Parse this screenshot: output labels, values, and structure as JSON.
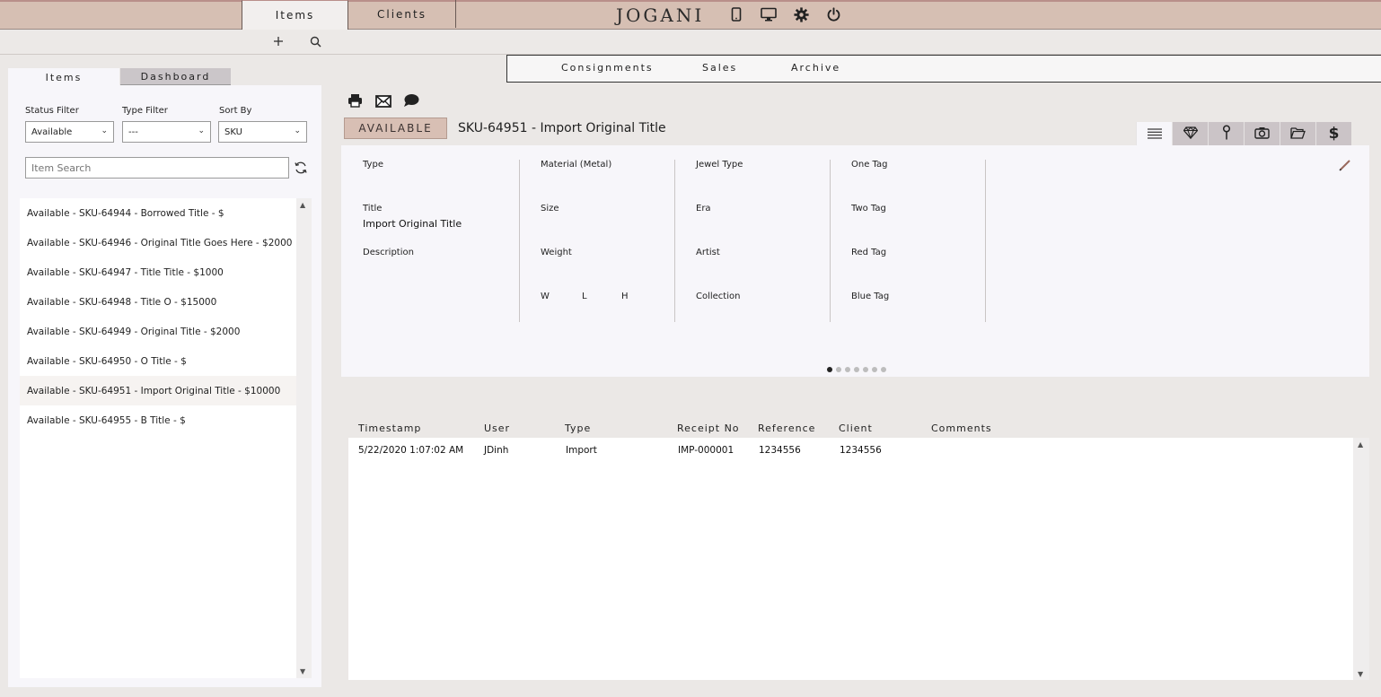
{
  "topbar": {
    "tabs": [
      {
        "label": "Items"
      },
      {
        "label": "Clients"
      }
    ],
    "logo": "JOGANI",
    "icons": [
      "tablet-icon",
      "desktop-icon",
      "gear-icon",
      "power-icon"
    ]
  },
  "subbar": {
    "icons": [
      "plus-icon",
      "search-icon"
    ]
  },
  "right_nav": [
    {
      "label": "Consignments"
    },
    {
      "label": "Sales"
    },
    {
      "label": "Archive"
    }
  ],
  "left": {
    "tabs": [
      {
        "label": "Items"
      },
      {
        "label": "Dashboard"
      }
    ],
    "filters": {
      "status": {
        "label": "Status Filter",
        "value": "Available"
      },
      "type": {
        "label": "Type Filter",
        "value": "---"
      },
      "sort": {
        "label": "Sort By",
        "value": "SKU"
      }
    },
    "search_placeholder": "Item Search",
    "items": [
      "Available - SKU-64944 - Borrowed Title - $",
      "Available - SKU-64946 - Original Title Goes Here - $2000",
      "Available - SKU-64947 - Title Title - $1000",
      "Available - SKU-64948 - Title O - $15000",
      "Available - SKU-64949 - Original Title - $2000",
      "Available - SKU-64950 - O Title - $",
      "Available - SKU-64951 - Import Original Title - $10000",
      "Available - SKU-64955 - B Title - $"
    ],
    "selected_index": 6
  },
  "detail": {
    "status": "AVAILABLE",
    "title": "SKU-64951 - Import Original Title",
    "toolbar_icons": [
      "print-icon",
      "email-icon",
      "comment-icon"
    ],
    "view_tabs": [
      "list-icon",
      "diamond-icon",
      "pin-icon",
      "camera-icon",
      "folder-icon",
      "dollar-icon"
    ],
    "col1": {
      "type": "Type",
      "title": "Title",
      "title_value": "Import Original Title",
      "description": "Description"
    },
    "col2": {
      "material": "Material (Metal)",
      "size": "Size",
      "weight": "Weight",
      "w": "W",
      "l": "L",
      "h": "H"
    },
    "col3": {
      "jewel_type": "Jewel Type",
      "era": "Era",
      "artist": "Artist",
      "collection": "Collection"
    },
    "col4": {
      "one_tag": "One Tag",
      "two_tag": "Two Tag",
      "red_tag": "Red Tag",
      "blue_tag": "Blue Tag"
    },
    "page_dots": 7,
    "active_dot": 0
  },
  "history": {
    "headers": [
      "Timestamp",
      "User",
      "Type",
      "Receipt No",
      "Reference",
      "Client",
      "Comments"
    ],
    "rows": [
      [
        "5/22/2020 1:07:02 AM",
        "JDinh",
        "Import",
        "IMP-000001",
        "1234556",
        "1234556",
        ""
      ]
    ]
  }
}
